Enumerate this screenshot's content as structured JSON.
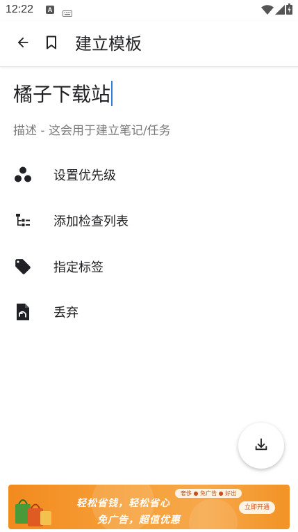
{
  "status_bar": {
    "time": "12:22",
    "notification_letter": "A"
  },
  "app_bar": {
    "title": "建立模板"
  },
  "editor": {
    "title_value": "橘子下载站",
    "description_placeholder": "描述 - 这会用于建立笔记/任务"
  },
  "menu": {
    "items": [
      {
        "label": "设置优先级",
        "icon": "priority-icon"
      },
      {
        "label": "添加检查列表",
        "icon": "checklist-icon"
      },
      {
        "label": "指定标签",
        "icon": "tag-icon"
      },
      {
        "label": "丢弃",
        "icon": "discard-icon"
      }
    ]
  },
  "ad": {
    "tags": "奢侈 ● 免广告 ● 好出",
    "line1": "轻松省钱，轻松省心",
    "line2": "免广告，超值优惠",
    "button": "立即开通"
  },
  "colors": {
    "accent": "#2f7fd8",
    "ad_orange": "#f6a13a"
  }
}
